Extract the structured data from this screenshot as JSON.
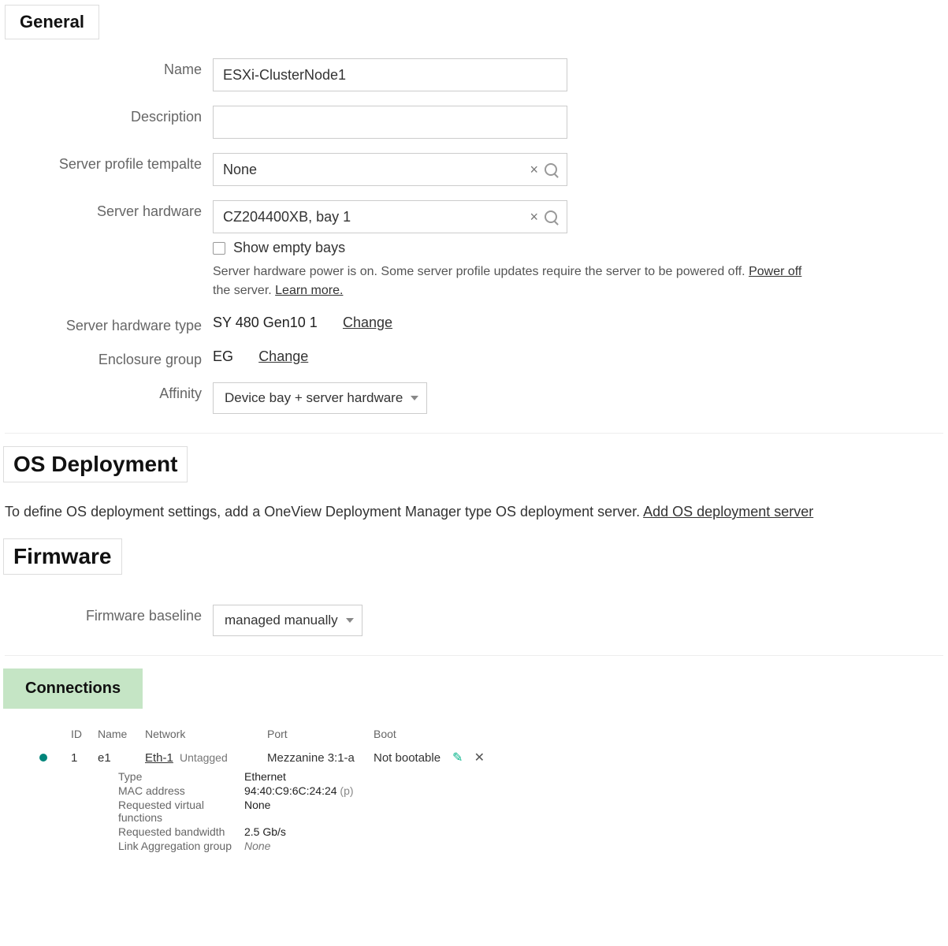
{
  "general": {
    "title": "General",
    "name_label": "Name",
    "name_value": "ESXi-ClusterNode1",
    "description_label": "Description",
    "description_value": "",
    "template_label": "Server profile tempalte",
    "template_value": "None",
    "hardware_label": "Server hardware",
    "hardware_value": "CZ204400XB, bay 1",
    "show_empty_label": "Show empty bays",
    "power_warning_1": "Server hardware power is on. Some server profile updates require the server to be powered off. ",
    "power_off_link": "Power off",
    "power_warning_2": " the server. ",
    "learn_more": "Learn more.",
    "hwtype_label": "Server hardware type",
    "hwtype_value": "SY 480 Gen10 1",
    "change_link": "Change",
    "eg_label": "Enclosure group",
    "eg_value": "EG",
    "affinity_label": "Affinity",
    "affinity_value": "Device bay + server hardware"
  },
  "os": {
    "title": "OS Deployment",
    "text": "To define OS deployment settings, add a OneView Deployment Manager type OS deployment server. ",
    "link": "Add OS deployment server"
  },
  "firmware": {
    "title": "Firmware",
    "baseline_label": "Firmware baseline",
    "baseline_value": "managed manually"
  },
  "connections": {
    "title": "Connections",
    "headers": {
      "id": "ID",
      "name": "Name",
      "network": "Network",
      "port": "Port",
      "boot": "Boot"
    },
    "row": {
      "id": "1",
      "name": "e1",
      "network": "Eth-1",
      "network_tag": "Untagged",
      "port": "Mezzanine 3:1-a",
      "boot": "Not bootable"
    },
    "details": {
      "type_label": "Type",
      "type_value": "Ethernet",
      "mac_label": "MAC address",
      "mac_value": "94:40:C9:6C:24:24",
      "mac_suffix": "(p)",
      "vf_label": "Requested virtual functions",
      "vf_value": "None",
      "bw_label": "Requested bandwidth",
      "bw_value": "2.5 Gb/s",
      "lag_label": "Link Aggregation group",
      "lag_value": "None"
    }
  }
}
